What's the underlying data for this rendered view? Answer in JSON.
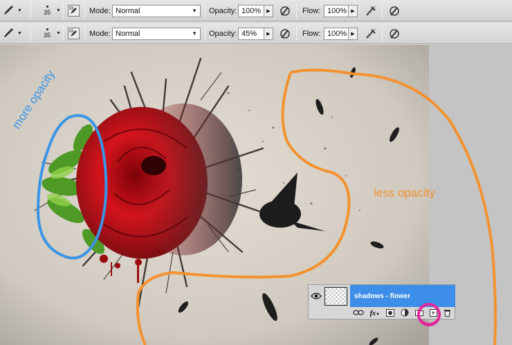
{
  "toolbar_rows": [
    {
      "brush_size": "35",
      "mode_label": "Mode:",
      "mode_value": "Normal",
      "opacity_label": "Opacity:",
      "opacity_value": "100%",
      "flow_label": "Flow:",
      "flow_value": "100%"
    },
    {
      "brush_size": "35",
      "mode_label": "Mode:",
      "mode_value": "Normal",
      "opacity_label": "Opacity:",
      "opacity_value": "45%",
      "flow_label": "Flow:",
      "flow_value": "100%"
    }
  ],
  "annotations": {
    "left": "more opacity",
    "right": "less opacity",
    "left_color": "#3a95e6",
    "right_color": "#f3922f",
    "highlight_color": "#e0289a"
  },
  "layers_panel": {
    "layer_name": "shadows - flower",
    "fx_label": "fx",
    "selected_color": "#3d8ee8"
  },
  "icons": [
    "brush-icon",
    "brush-panel-icon",
    "airbrush-icon",
    "tablet-pressure-icon",
    "eye-icon",
    "link-icon",
    "fx-icon",
    "mask-icon",
    "adjustment-icon",
    "folder-icon",
    "new-layer-icon",
    "trash-icon"
  ]
}
